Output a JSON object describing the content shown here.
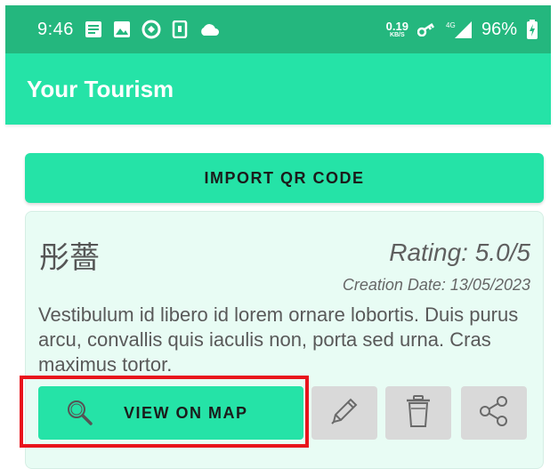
{
  "status_bar": {
    "time": "9:46",
    "net_speed_value": "0.19",
    "net_speed_unit": "KB/S",
    "network": "4G",
    "battery": "96%"
  },
  "app_bar": {
    "title": "Your Tourism"
  },
  "import_button": {
    "label": "IMPORT QR CODE"
  },
  "card": {
    "name": "彤薔",
    "rating": "Rating: 5.0/5",
    "creation_date": "Creation Date: 13/05/2023",
    "description": "Vestibulum id libero id lorem ornare lobortis. Duis purus arcu, convallis quis iaculis non, porta sed urna. Cras maximus tortor.",
    "map_button_label": "VIEW ON MAP",
    "actions": [
      "edit-icon",
      "delete-icon",
      "share-icon"
    ]
  },
  "colors": {
    "accent": "#25e3a7",
    "status_bar": "#24b77e",
    "highlight": "#e8141c",
    "card_bg": "#e8fcf4"
  }
}
